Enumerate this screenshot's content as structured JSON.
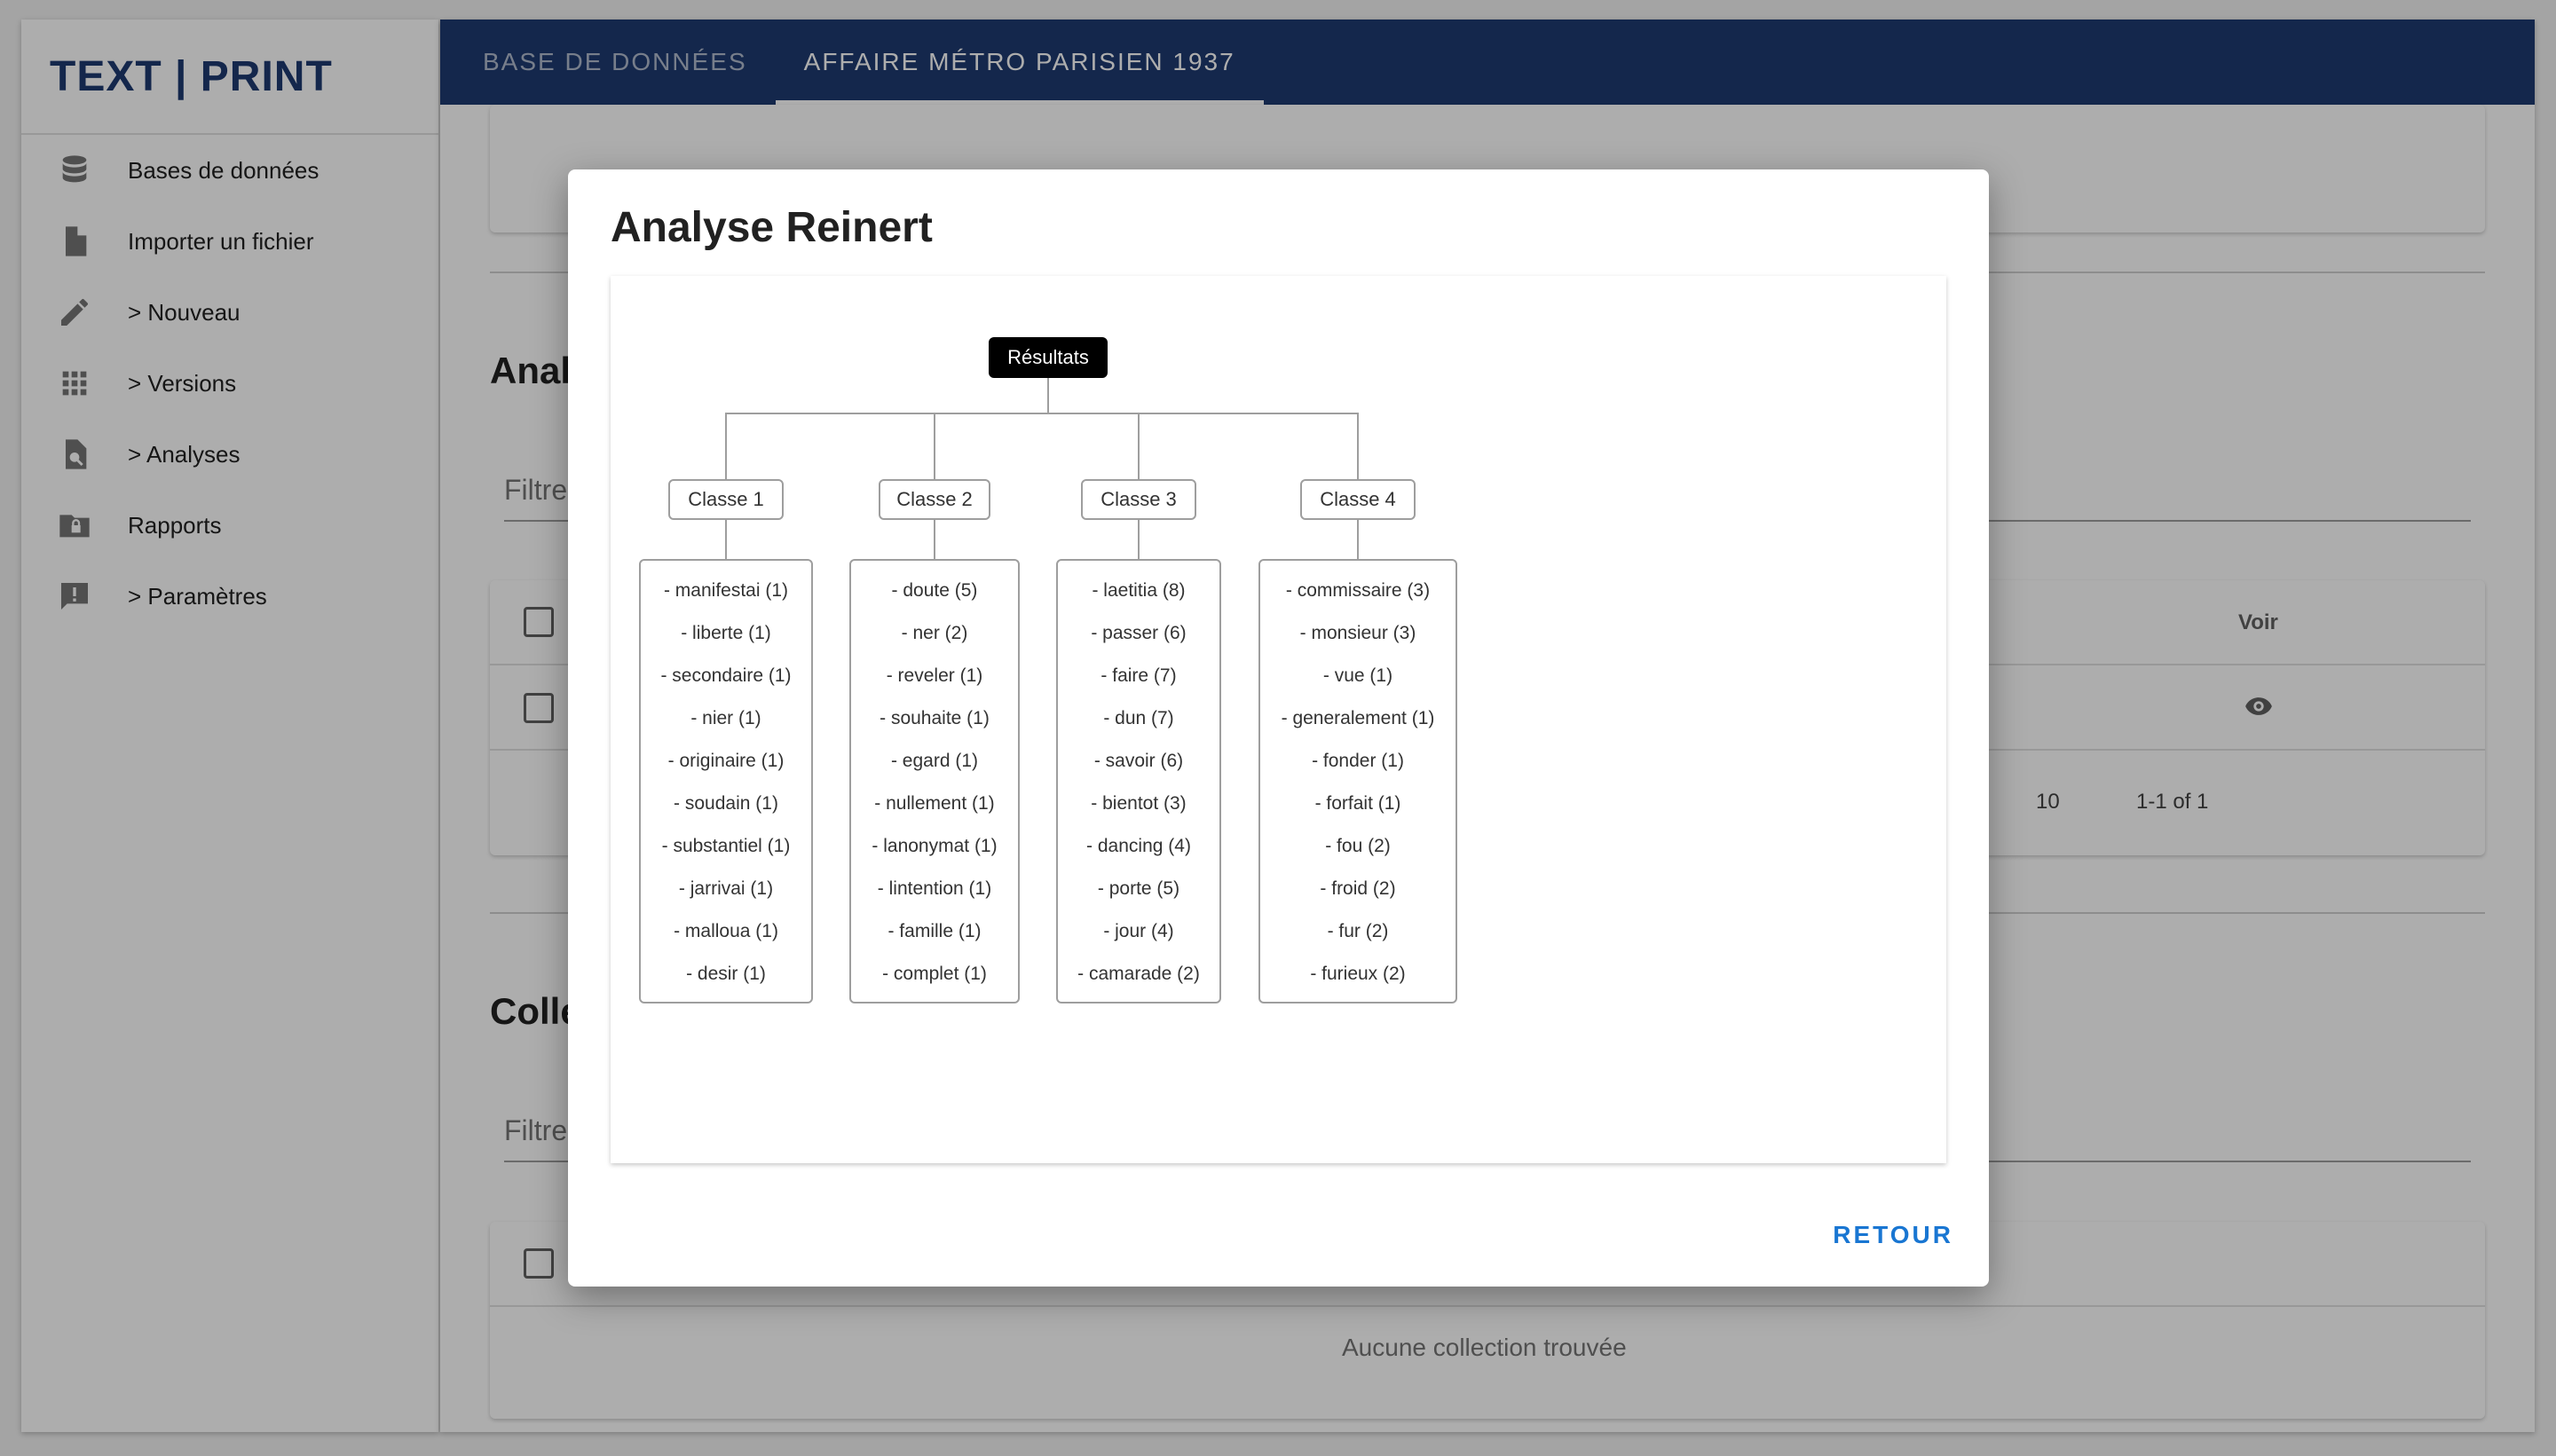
{
  "app": {
    "logo": "TEXT | PRINT"
  },
  "sidebar": {
    "items": [
      {
        "label": "Bases de données",
        "icon": "database-icon"
      },
      {
        "label": "Importer un fichier",
        "icon": "file-icon"
      },
      {
        "label": "> Nouveau",
        "icon": "pencil-icon"
      },
      {
        "label": "> Versions",
        "icon": "apps-grid-icon"
      },
      {
        "label": "> Analyses",
        "icon": "file-search-icon"
      },
      {
        "label": "Rapports",
        "icon": "folder-lock-icon"
      },
      {
        "label": "> Paramètres",
        "icon": "feedback-icon"
      }
    ]
  },
  "tabs": [
    {
      "label": "BASE DE DONNÉES",
      "active": false
    },
    {
      "label": "AFFAIRE MÉTRO PARISIEN 1937",
      "active": true
    }
  ],
  "analyses": {
    "title": "Analyses",
    "filter_placeholder": "Filtre",
    "col_voir": "Voir",
    "per_page": "10",
    "range": "1-1 of 1"
  },
  "collections": {
    "title": "Collections",
    "filter_placeholder": "Filtre",
    "empty": "Aucune collection trouvée"
  },
  "dialog": {
    "title": "Analyse Reinert",
    "action": "RETOUR",
    "tree": {
      "root": "Résultats",
      "classes": [
        {
          "name": "Classe 1",
          "words": [
            "- manifestai (1)",
            "- liberte (1)",
            "- secondaire (1)",
            "- nier (1)",
            "- originaire (1)",
            "- soudain (1)",
            "- substantiel (1)",
            "- jarrivai (1)",
            "- malloua (1)",
            "- desir (1)"
          ]
        },
        {
          "name": "Classe 2",
          "words": [
            "- doute (5)",
            "- ner (2)",
            "- reveler (1)",
            "- souhaite (1)",
            "- egard (1)",
            "- nullement (1)",
            "- lanonymat (1)",
            "- lintention (1)",
            "- famille (1)",
            "- complet (1)"
          ]
        },
        {
          "name": "Classe 3",
          "words": [
            "- laetitia (8)",
            "- passer (6)",
            "- faire (7)",
            "- dun (7)",
            "- savoir (6)",
            "- bientot (3)",
            "- dancing (4)",
            "- porte (5)",
            "- jour (4)",
            "- camarade (2)"
          ]
        },
        {
          "name": "Classe 4",
          "words": [
            "- commissaire (3)",
            "- monsieur (3)",
            "- vue (1)",
            "- generalement (1)",
            "- fonder (1)",
            "- forfait (1)",
            "- fou (2)",
            "- froid (2)",
            "- fur (2)",
            "- furieux (2)"
          ]
        }
      ]
    }
  }
}
